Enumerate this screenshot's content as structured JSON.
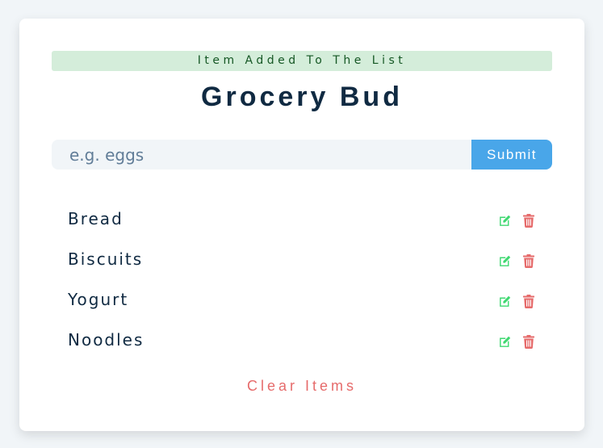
{
  "alert": {
    "text": "Item Added To The List",
    "color": "#d4edda"
  },
  "header": {
    "title": "Grocery Bud"
  },
  "form": {
    "placeholder": "e.g. eggs",
    "value": "",
    "submit_label": "Submit",
    "accent": "#49a6e9"
  },
  "items": [
    {
      "name": "Bread"
    },
    {
      "name": "Biscuits"
    },
    {
      "name": "Yogurt"
    },
    {
      "name": "Noodles"
    }
  ],
  "icons": {
    "edit": "edit-icon",
    "delete": "trash-icon",
    "edit_color": "#3ed870",
    "delete_color": "#e66b6b"
  },
  "footer": {
    "clear_label": "Clear Items"
  }
}
